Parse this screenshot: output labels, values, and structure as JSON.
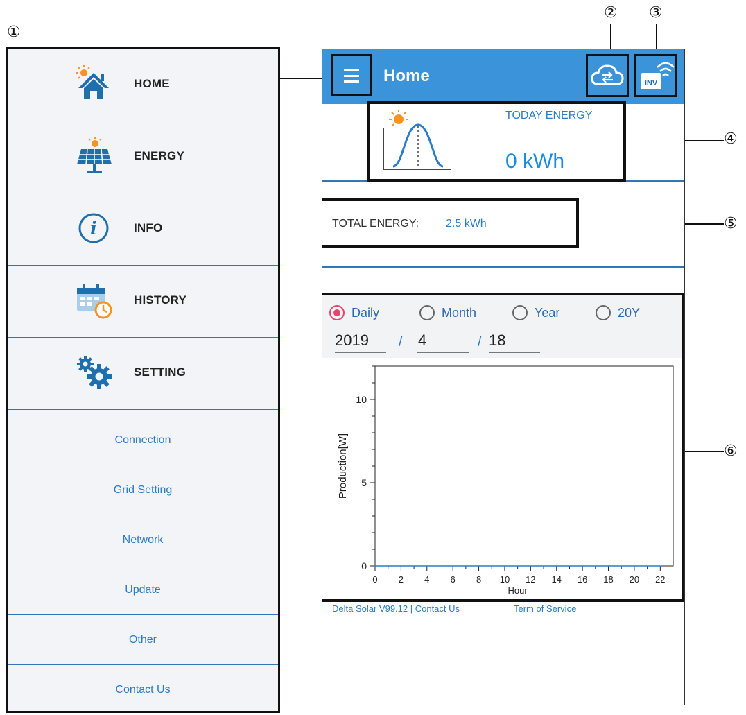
{
  "callouts": [
    "①",
    "②",
    "③",
    "④",
    "⑤",
    "⑥"
  ],
  "menu": {
    "items": [
      {
        "label": "HOME",
        "icon": "home-sun-icon"
      },
      {
        "label": "ENERGY",
        "icon": "solar-panel-icon"
      },
      {
        "label": "INFO",
        "icon": "info-icon"
      },
      {
        "label": "HISTORY",
        "icon": "calendar-clock-icon"
      },
      {
        "label": "SETTING",
        "icon": "gears-icon"
      }
    ],
    "sub_items": [
      "Connection",
      "Grid Setting",
      "Network",
      "Update",
      "Other",
      "Contact Us"
    ]
  },
  "appbar": {
    "title": "Home",
    "menu_icon": "hamburger-icon",
    "cloud_icon": "cloud-sync-icon",
    "inverter_icon": "inverter-wifi-icon",
    "inverter_badge": "INV"
  },
  "today": {
    "label": "TODAY ENERGY",
    "value": "0 kWh"
  },
  "total": {
    "label": "TOTAL ENERGY:",
    "value": "2.5 kWh"
  },
  "period": {
    "options": [
      "Daily",
      "Month",
      "Year",
      "20Y"
    ],
    "selected": "Daily"
  },
  "date": {
    "year": "2019",
    "month": "4",
    "day": "18",
    "separator": "/"
  },
  "footer": {
    "left": "Delta Solar V99.12 | Contact Us",
    "right": "Term of Service"
  },
  "colors": {
    "appbar": "#3b93d9",
    "accent_text": "#2a7cc7",
    "radio_selected": "#e8436e",
    "divider": "#2f77bd"
  },
  "chart_data": {
    "type": "line",
    "xlabel": "Hour",
    "ylabel": "Production[W]",
    "x": [
      0,
      2,
      4,
      6,
      8,
      10,
      12,
      14,
      16,
      18,
      20,
      22
    ],
    "series": [
      {
        "values": [
          0,
          0,
          0,
          0,
          0,
          0,
          0,
          0,
          0,
          0,
          0,
          0
        ]
      }
    ],
    "xticks": [
      "0",
      "2",
      "4",
      "6",
      "8",
      "10",
      "12",
      "14",
      "16",
      "18",
      "20",
      "22"
    ],
    "yticks": [
      "0",
      "5",
      "10"
    ],
    "xlim": [
      0,
      23
    ],
    "ylim": [
      0,
      12
    ],
    "grid": false
  }
}
